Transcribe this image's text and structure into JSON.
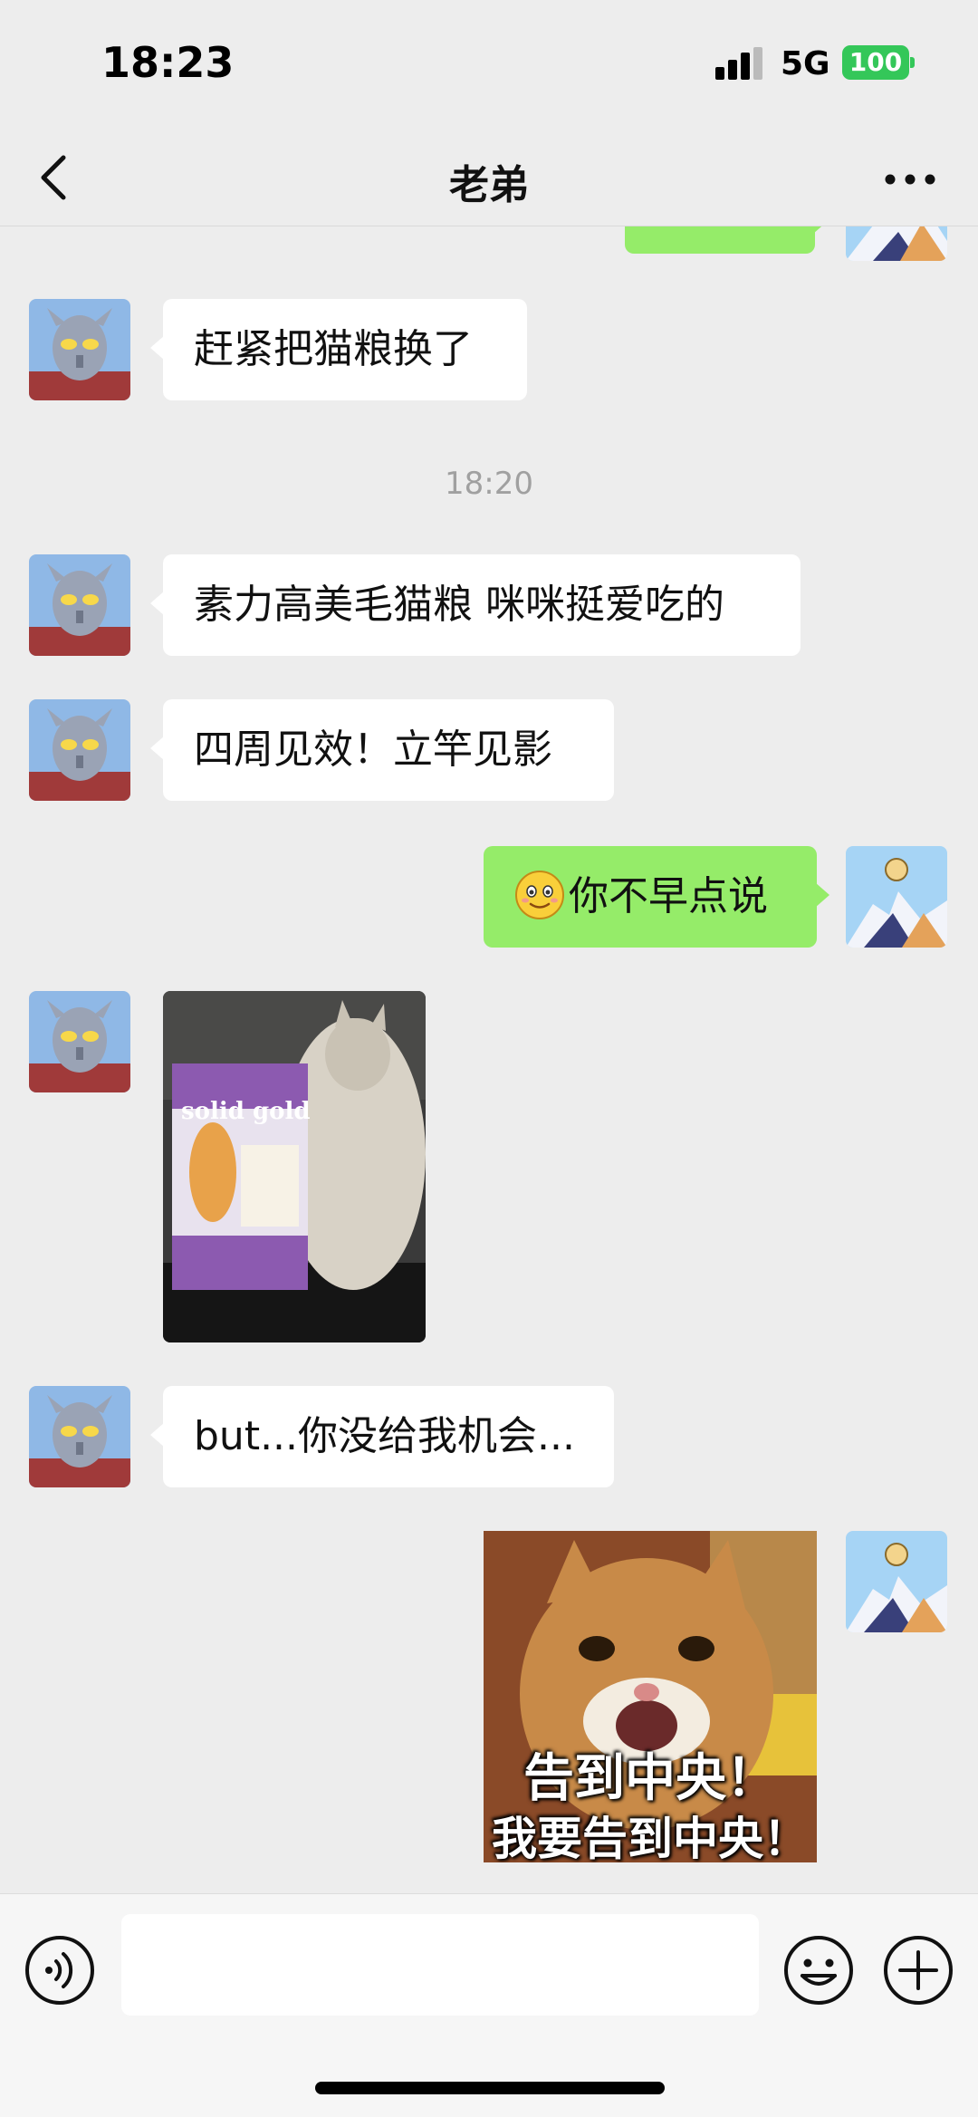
{
  "status_bar": {
    "time": "18:23",
    "network": "5G",
    "battery": "100",
    "signal_bars": 3
  },
  "header": {
    "title": "老弟"
  },
  "messages": [
    {
      "side": "in",
      "text": "赶紧把猫粮换了"
    },
    {
      "type": "time",
      "text": "18:20"
    },
    {
      "side": "in",
      "text": "素力高美毛猫粮 咪咪挺爱吃的"
    },
    {
      "side": "in",
      "text": "四周见效！立竿见影"
    },
    {
      "side": "out",
      "emoji": "smiling-face-icon",
      "text": "你不早点说"
    },
    {
      "side": "in",
      "type": "photo",
      "brand_text": "solid gold"
    },
    {
      "side": "in",
      "text": "but...你没给我机会..."
    },
    {
      "side": "out",
      "type": "sticker",
      "caption_line1": "告到中央！",
      "caption_line2": "我要告到中央！"
    }
  ],
  "input_bar": {
    "placeholder": ""
  },
  "colors": {
    "out_bubble": "#95ec69",
    "in_bubble": "#ffffff",
    "background": "#ededed",
    "battery": "#34c759"
  }
}
